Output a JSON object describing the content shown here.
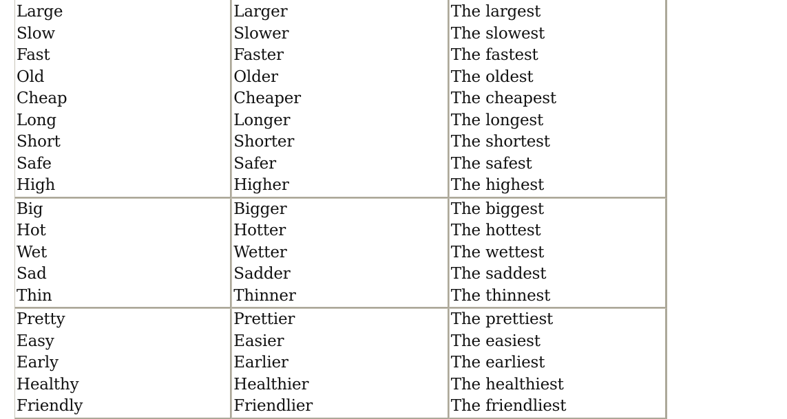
{
  "table": {
    "groups": [
      {
        "rows": [
          {
            "base": "Large",
            "comparative": "Larger",
            "superlative": "The largest"
          },
          {
            "base": "Slow",
            "comparative": "Slower",
            "superlative": "The slowest"
          },
          {
            "base": "Fast",
            "comparative": "Faster",
            "superlative": "The fastest"
          },
          {
            "base": "Old",
            "comparative": "Older",
            "superlative": "The oldest"
          },
          {
            "base": "Cheap",
            "comparative": "Cheaper",
            "superlative": "The cheapest"
          },
          {
            "base": "Long",
            "comparative": "Longer",
            "superlative": "The longest"
          },
          {
            "base": "Short",
            "comparative": "Shorter",
            "superlative": "The shortest"
          },
          {
            "base": "Safe",
            "comparative": "Safer",
            "superlative": "The safest"
          },
          {
            "base": "High",
            "comparative": "Higher",
            "superlative": "The highest"
          }
        ]
      },
      {
        "rows": [
          {
            "base": "Big",
            "comparative": "Bigger",
            "superlative": "The biggest"
          },
          {
            "base": "Hot",
            "comparative": "Hotter",
            "superlative": "The hottest"
          },
          {
            "base": "Wet",
            "comparative": "Wetter",
            "superlative": "The wettest"
          },
          {
            "base": "Sad",
            "comparative": "Sadder",
            "superlative": "The saddest"
          },
          {
            "base": "Thin",
            "comparative": "Thinner",
            "superlative": "The thinnest"
          }
        ]
      },
      {
        "rows": [
          {
            "base": "Pretty",
            "comparative": "Prettier",
            "superlative": "The prettiest"
          },
          {
            "base": "Easy",
            "comparative": "Easier",
            "superlative": "The easiest"
          },
          {
            "base": "Early",
            "comparative": "Earlier",
            "superlative": "The earliest"
          },
          {
            "base": "Healthy",
            "comparative": "Healthier",
            "superlative": "The healthiest"
          },
          {
            "base": "Friendly",
            "comparative": "Friendlier",
            "superlative": "The friendliest"
          }
        ]
      }
    ]
  }
}
